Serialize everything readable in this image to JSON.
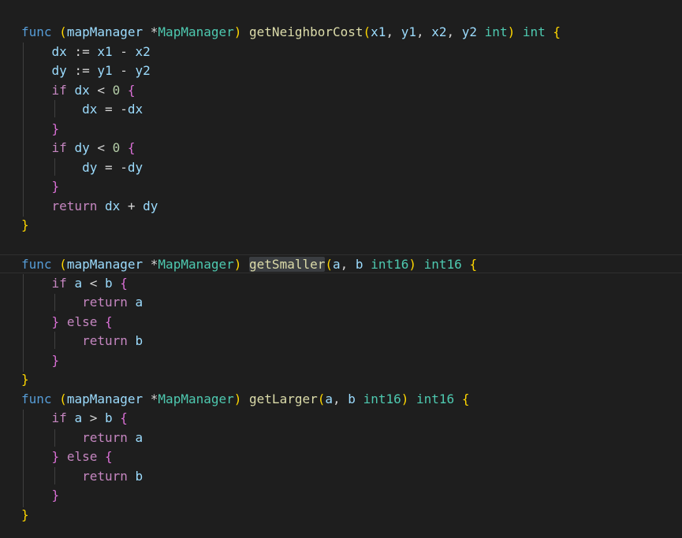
{
  "colors": {
    "background": "#1e1e1e",
    "keyword_blue": "#569cd6",
    "keyword_control": "#c586c0",
    "function": "#dcdcaa",
    "type": "#4ec9b0",
    "variable": "#9cdcfe",
    "punct": "#d4d4d4",
    "number": "#b5cea8",
    "bracket_gold": "#ffd700",
    "bracket_pink": "#da70d6",
    "bracket_blue": "#179fff"
  },
  "lines": [
    [
      [
        "func",
        "kw"
      ],
      [
        " ",
        "p"
      ],
      [
        "(",
        "bg"
      ],
      [
        "mapManager",
        "v"
      ],
      [
        " ",
        "p"
      ],
      [
        "*",
        "p"
      ],
      [
        "MapManager",
        "t"
      ],
      [
        ")",
        "bg"
      ],
      [
        " ",
        "p"
      ],
      [
        "getNeighborCost",
        "f"
      ],
      [
        "(",
        "bg"
      ],
      [
        "x1",
        "v"
      ],
      [
        ", ",
        "p"
      ],
      [
        "y1",
        "v"
      ],
      [
        ", ",
        "p"
      ],
      [
        "x2",
        "v"
      ],
      [
        ", ",
        "p"
      ],
      [
        "y2",
        "v"
      ],
      [
        " ",
        "p"
      ],
      [
        "int",
        "t"
      ],
      [
        ")",
        "bg"
      ],
      [
        " ",
        "p"
      ],
      [
        "int",
        "t"
      ],
      [
        " ",
        "p"
      ],
      [
        "{",
        "bg"
      ]
    ],
    [
      [
        "    ",
        "p"
      ],
      [
        "dx",
        "v"
      ],
      [
        " := ",
        "p"
      ],
      [
        "x1",
        "v"
      ],
      [
        " - ",
        "p"
      ],
      [
        "x2",
        "v"
      ]
    ],
    [
      [
        "    ",
        "p"
      ],
      [
        "dy",
        "v"
      ],
      [
        " := ",
        "p"
      ],
      [
        "y1",
        "v"
      ],
      [
        " - ",
        "p"
      ],
      [
        "y2",
        "v"
      ]
    ],
    [
      [
        "    ",
        "p"
      ],
      [
        "if",
        "kc"
      ],
      [
        " ",
        "p"
      ],
      [
        "dx",
        "v"
      ],
      [
        " < ",
        "p"
      ],
      [
        "0",
        "n"
      ],
      [
        " ",
        "p"
      ],
      [
        "{",
        "bp"
      ]
    ],
    [
      [
        "        ",
        "p"
      ],
      [
        "dx",
        "v"
      ],
      [
        " = -",
        "p"
      ],
      [
        "dx",
        "v"
      ]
    ],
    [
      [
        "    ",
        "p"
      ],
      [
        "}",
        "bp"
      ]
    ],
    [
      [
        "    ",
        "p"
      ],
      [
        "if",
        "kc"
      ],
      [
        " ",
        "p"
      ],
      [
        "dy",
        "v"
      ],
      [
        " < ",
        "p"
      ],
      [
        "0",
        "n"
      ],
      [
        " ",
        "p"
      ],
      [
        "{",
        "bp"
      ]
    ],
    [
      [
        "        ",
        "p"
      ],
      [
        "dy",
        "v"
      ],
      [
        " = -",
        "p"
      ],
      [
        "dy",
        "v"
      ]
    ],
    [
      [
        "    ",
        "p"
      ],
      [
        "}",
        "bp"
      ]
    ],
    [
      [
        "    ",
        "p"
      ],
      [
        "return",
        "kc"
      ],
      [
        " ",
        "p"
      ],
      [
        "dx",
        "v"
      ],
      [
        " + ",
        "p"
      ],
      [
        "dy",
        "v"
      ]
    ],
    [
      [
        "}",
        "bg"
      ]
    ],
    [],
    [
      [
        "func",
        "kw"
      ],
      [
        " ",
        "p"
      ],
      [
        "(",
        "bg"
      ],
      [
        "mapManager",
        "v"
      ],
      [
        " ",
        "p"
      ],
      [
        "*",
        "p"
      ],
      [
        "MapManager",
        "t"
      ],
      [
        ")",
        "bg"
      ],
      [
        " ",
        "p"
      ],
      [
        "getSmaller",
        "fh"
      ],
      [
        "(",
        "bg"
      ],
      [
        "a",
        "v"
      ],
      [
        ", ",
        "p"
      ],
      [
        "b",
        "v"
      ],
      [
        " ",
        "p"
      ],
      [
        "int16",
        "t"
      ],
      [
        ")",
        "bg"
      ],
      [
        " ",
        "p"
      ],
      [
        "int16",
        "t"
      ],
      [
        " ",
        "p"
      ],
      [
        "{",
        "bg"
      ]
    ],
    [
      [
        "    ",
        "p"
      ],
      [
        "if",
        "kc"
      ],
      [
        " ",
        "p"
      ],
      [
        "a",
        "v"
      ],
      [
        " < ",
        "p"
      ],
      [
        "b",
        "v"
      ],
      [
        " ",
        "p"
      ],
      [
        "{",
        "bp"
      ]
    ],
    [
      [
        "        ",
        "p"
      ],
      [
        "return",
        "kc"
      ],
      [
        " ",
        "p"
      ],
      [
        "a",
        "v"
      ]
    ],
    [
      [
        "    ",
        "p"
      ],
      [
        "}",
        "bp"
      ],
      [
        " ",
        "p"
      ],
      [
        "else",
        "kc"
      ],
      [
        " ",
        "p"
      ],
      [
        "{",
        "bp"
      ]
    ],
    [
      [
        "        ",
        "p"
      ],
      [
        "return",
        "kc"
      ],
      [
        " ",
        "p"
      ],
      [
        "b",
        "v"
      ]
    ],
    [
      [
        "    ",
        "p"
      ],
      [
        "}",
        "bp"
      ]
    ],
    [
      [
        "}",
        "bg"
      ]
    ],
    [
      [
        "func",
        "kw"
      ],
      [
        " ",
        "p"
      ],
      [
        "(",
        "bg"
      ],
      [
        "mapManager",
        "v"
      ],
      [
        " ",
        "p"
      ],
      [
        "*",
        "p"
      ],
      [
        "MapManager",
        "t"
      ],
      [
        ")",
        "bg"
      ],
      [
        " ",
        "p"
      ],
      [
        "getLarger",
        "f"
      ],
      [
        "(",
        "bg"
      ],
      [
        "a",
        "v"
      ],
      [
        ", ",
        "p"
      ],
      [
        "b",
        "v"
      ],
      [
        " ",
        "p"
      ],
      [
        "int16",
        "t"
      ],
      [
        ")",
        "bg"
      ],
      [
        " ",
        "p"
      ],
      [
        "int16",
        "t"
      ],
      [
        " ",
        "p"
      ],
      [
        "{",
        "bg"
      ]
    ],
    [
      [
        "    ",
        "p"
      ],
      [
        "if",
        "kc"
      ],
      [
        " ",
        "p"
      ],
      [
        "a",
        "v"
      ],
      [
        " > ",
        "p"
      ],
      [
        "b",
        "v"
      ],
      [
        " ",
        "p"
      ],
      [
        "{",
        "bp"
      ]
    ],
    [
      [
        "        ",
        "p"
      ],
      [
        "return",
        "kc"
      ],
      [
        " ",
        "p"
      ],
      [
        "a",
        "v"
      ]
    ],
    [
      [
        "    ",
        "p"
      ],
      [
        "}",
        "bp"
      ],
      [
        " ",
        "p"
      ],
      [
        "else",
        "kc"
      ],
      [
        " ",
        "p"
      ],
      [
        "{",
        "bp"
      ]
    ],
    [
      [
        "        ",
        "p"
      ],
      [
        "return",
        "kc"
      ],
      [
        " ",
        "p"
      ],
      [
        "b",
        "v"
      ]
    ],
    [
      [
        "    ",
        "p"
      ],
      [
        "}",
        "bp"
      ]
    ],
    [
      [
        "}",
        "bg"
      ]
    ]
  ]
}
